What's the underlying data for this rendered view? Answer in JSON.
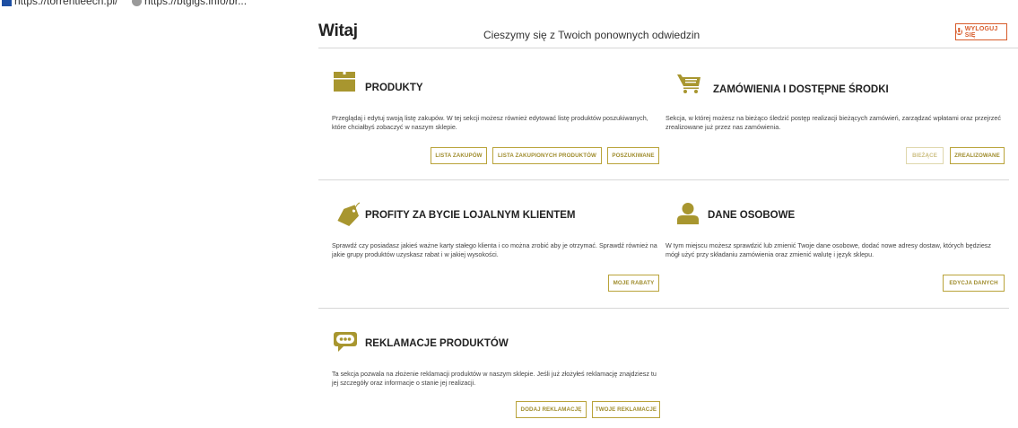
{
  "bookmarks": [
    {
      "label": "https://torrentleech.pl/"
    },
    {
      "label": "https://btgigs.info/br..."
    }
  ],
  "header": {
    "welcome": "Witaj",
    "subtitle": "Cieszymy się z Twoich ponownych odwiedzin",
    "logout_label": "WYLOGUJ SIĘ"
  },
  "colors": {
    "accent": "#b9a33a",
    "icon": "#a8962f",
    "logout": "#d75b2a"
  },
  "sections": {
    "products": {
      "icon": "box-icon",
      "title": "PRODUKTY",
      "description": "Przeglądaj i edytuj swoją listę zakupów. W tej sekcji możesz również edytować listę produktów poszukiwanych, które chciałbyś zobaczyć w naszym sklepie.",
      "buttons": [
        "LISTA ZAKUPÓW",
        "LISTA ZAKUPIONYCH PRODUKTÓW",
        "POSZUKIWANE"
      ]
    },
    "orders": {
      "icon": "cart-icon",
      "title": "ZAMÓWIENIA I DOSTĘPNE ŚRODKI",
      "description": "Sekcja, w której możesz na bieżąco śledzić postęp realizacji bieżących zamówień, zarządzać wpłatami oraz przejrzeć zrealizowane już przez nas zamówienia.",
      "buttons": [
        "BIEŻĄCE",
        "ZREALIZOWANE"
      ]
    },
    "loyalty": {
      "icon": "tag-icon",
      "title": "PROFITY ZA BYCIE LOJALNYM KLIENTEM",
      "description": "Sprawdź czy posiadasz jakieś ważne karty stałego klienta i co można zrobić aby je otrzymać. Sprawdź również na jakie grupy produktów uzyskasz rabat i w jakiej wysokości.",
      "buttons": [
        "MOJE RABATY"
      ]
    },
    "personal": {
      "icon": "user-icon",
      "title": "DANE OSOBOWE",
      "description": "W tym miejscu możesz sprawdzić lub zmienić Twoje dane osobowe, dodać nowe adresy dostaw, których będziesz mógł użyć przy składaniu zamówienia oraz zmienić walutę i język sklepu.",
      "buttons": [
        "EDYCJA DANYCH"
      ]
    },
    "complaints": {
      "icon": "chat-icon",
      "title": "REKLAMACJE PRODUKTÓW",
      "description": "Ta sekcja pozwala na złożenie reklamacji produktów w naszym sklepie. Jeśli już złożyłeś reklamację znajdziesz tu jej szczegóły oraz informacje o stanie jej realizacji.",
      "buttons": [
        "DODAJ REKLAMACJĘ",
        "TWOJE REKLAMACJE"
      ]
    }
  }
}
